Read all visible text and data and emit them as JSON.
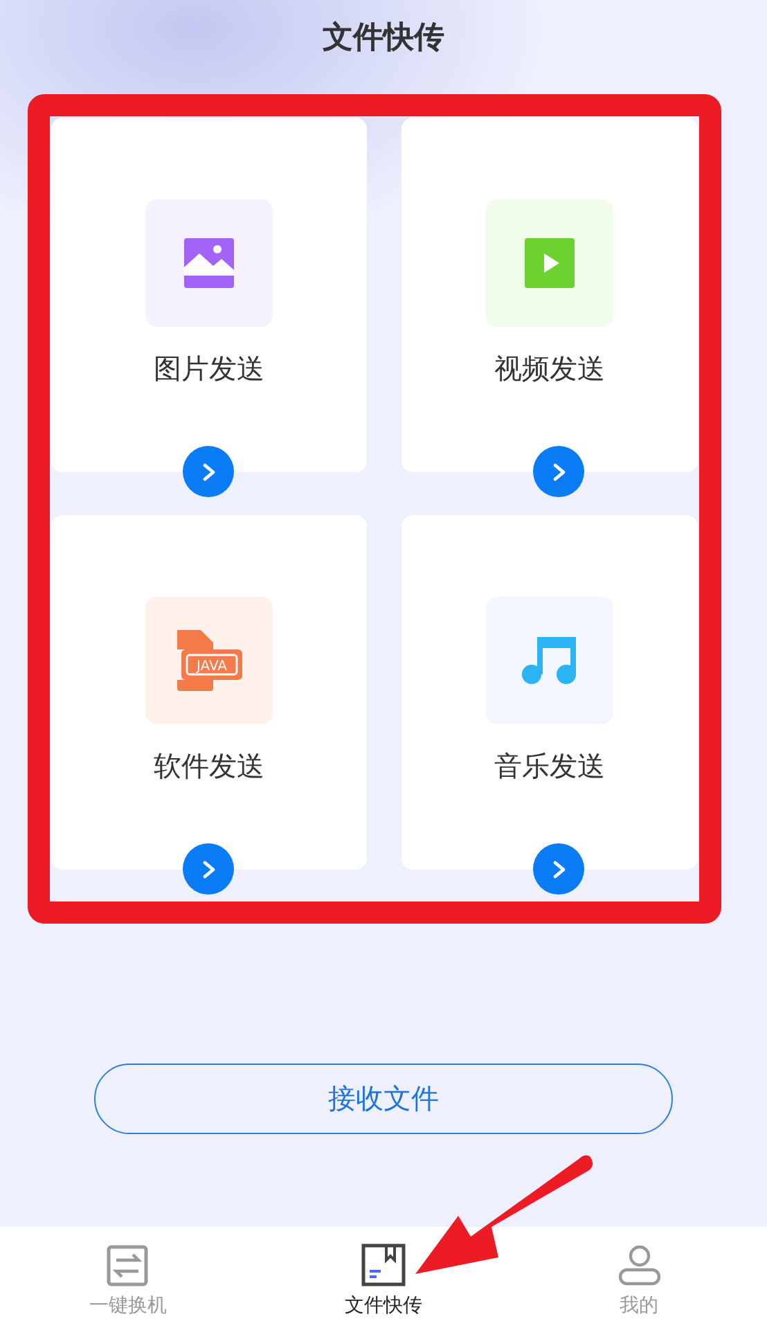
{
  "title": "文件快传",
  "cards": [
    {
      "kind": "image",
      "label": "图片发送"
    },
    {
      "kind": "video",
      "label": "视频发送"
    },
    {
      "kind": "software",
      "label": "软件发送",
      "icon_text": "JAVA"
    },
    {
      "kind": "music",
      "label": "音乐发送"
    }
  ],
  "receive_button": "接收文件",
  "tabs": [
    {
      "kind": "switch",
      "label": "一键换机",
      "selected": false
    },
    {
      "kind": "files",
      "label": "文件快传",
      "selected": true
    },
    {
      "kind": "profile",
      "label": "我的",
      "selected": false
    }
  ]
}
